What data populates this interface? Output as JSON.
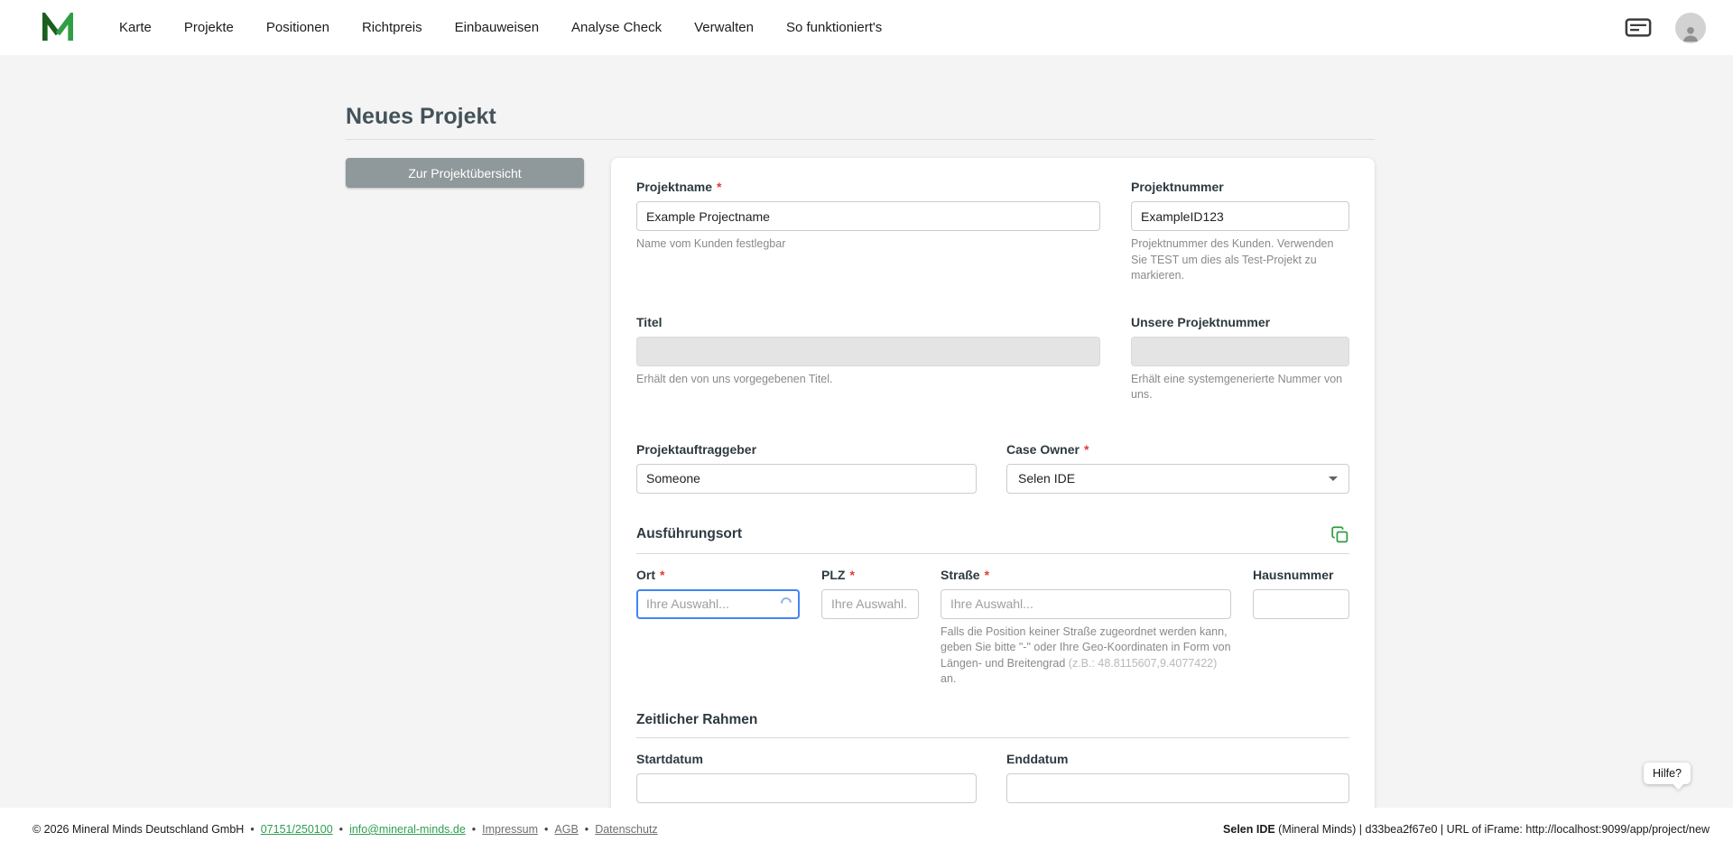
{
  "colors": {
    "accent_green": "#2f9e44",
    "focus_blue": "#4285f4",
    "required_red": "#e53935"
  },
  "navbar": {
    "items": [
      "Karte",
      "Projekte",
      "Positionen",
      "Richtpreis",
      "Einbauweisen",
      "Analyse Check",
      "Verwalten",
      "So funktioniert's"
    ]
  },
  "page": {
    "title": "Neues Projekt",
    "overview_button": "Zur Projektübersicht",
    "required_marker": "*",
    "help_button": "Hilfe?"
  },
  "form": {
    "projektname": {
      "label": "Projektname",
      "value": "Example Projectname",
      "helper": "Name vom Kunden festlegbar"
    },
    "projektnummer": {
      "label": "Projektnummer",
      "value": "ExampleID123",
      "helper": "Projektnummer des Kunden. Verwenden Sie TEST um dies als Test-Projekt zu markieren."
    },
    "titel": {
      "label": "Titel",
      "helper": "Erhält den von uns vorgegebenen Titel."
    },
    "unsere_projektnummer": {
      "label": "Unsere Projektnummer",
      "helper": "Erhält eine systemgenerierte Nummer von uns."
    },
    "projektauftraggeber": {
      "label": "Projektauftraggeber",
      "value": "Someone"
    },
    "case_owner": {
      "label": "Case Owner",
      "value": "Selen IDE"
    },
    "ausfuehrungsort": {
      "section_title": "Ausführungsort",
      "ort": {
        "label": "Ort",
        "placeholder": "Ihre Auswahl..."
      },
      "plz": {
        "label": "PLZ",
        "placeholder": "Ihre Auswahl."
      },
      "strasse": {
        "label": "Straße",
        "placeholder": "Ihre Auswahl...",
        "helper_main": "Falls die Position keiner Straße zugeordnet werden kann, geben Sie bitte \"-\" oder Ihre Geo-Koordinaten in Form von Längen- und Breitengrad ",
        "helper_example": "(z.B.: 48.8115607,9.4077422)",
        "helper_suffix": " an."
      },
      "hausnummer": {
        "label": "Hausnummer"
      }
    },
    "zeitlicher_rahmen": {
      "section_title": "Zeitlicher Rahmen",
      "startdatum": {
        "label": "Startdatum"
      },
      "enddatum": {
        "label": "Enddatum"
      }
    }
  },
  "footer": {
    "copyright": "© 2026 Mineral Minds Deutschland GmbH",
    "separator": "•",
    "phone": "07151/250100",
    "email": "info@mineral-minds.de",
    "impressum": "Impressum",
    "agb": "AGB",
    "datenschutz": "Datenschutz",
    "session_user": "Selen IDE",
    "session_rest": " (Mineral Minds) | d33bea2f67e0 | URL of iFrame: http://localhost:9099/app/project/new"
  }
}
